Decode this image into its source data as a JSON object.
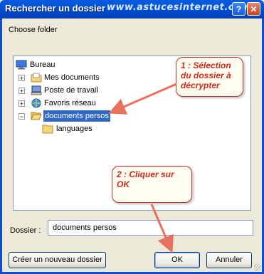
{
  "window": {
    "title": "Rechercher un dossier",
    "watermark": "www.astucesinternet.com",
    "help_label": "?",
    "close_label": "✕"
  },
  "instruction": "Choose folder",
  "tree": {
    "items": [
      {
        "label": "Bureau",
        "icon": "desktop-icon"
      },
      {
        "label": "Mes documents",
        "icon": "my-documents-icon"
      },
      {
        "label": "Poste de travail",
        "icon": "my-computer-icon"
      },
      {
        "label": "Favoris réseau",
        "icon": "network-icon"
      },
      {
        "label": "documents persos",
        "icon": "folder-open-icon"
      },
      {
        "label": "languages",
        "icon": "folder-icon"
      }
    ]
  },
  "callouts": {
    "step1": "1 : Sélection du dossier à décrypter",
    "step2": "2 : Cliquer sur OK"
  },
  "folder_field": {
    "label": "Dossier :",
    "value": "documents persos"
  },
  "buttons": {
    "new_folder": "Créer un nouveau dossier",
    "ok": "OK",
    "cancel": "Annuler"
  },
  "colors": {
    "titlebar": "#0452d6",
    "selection": "#316ac5",
    "annotation": "#d0271d"
  }
}
